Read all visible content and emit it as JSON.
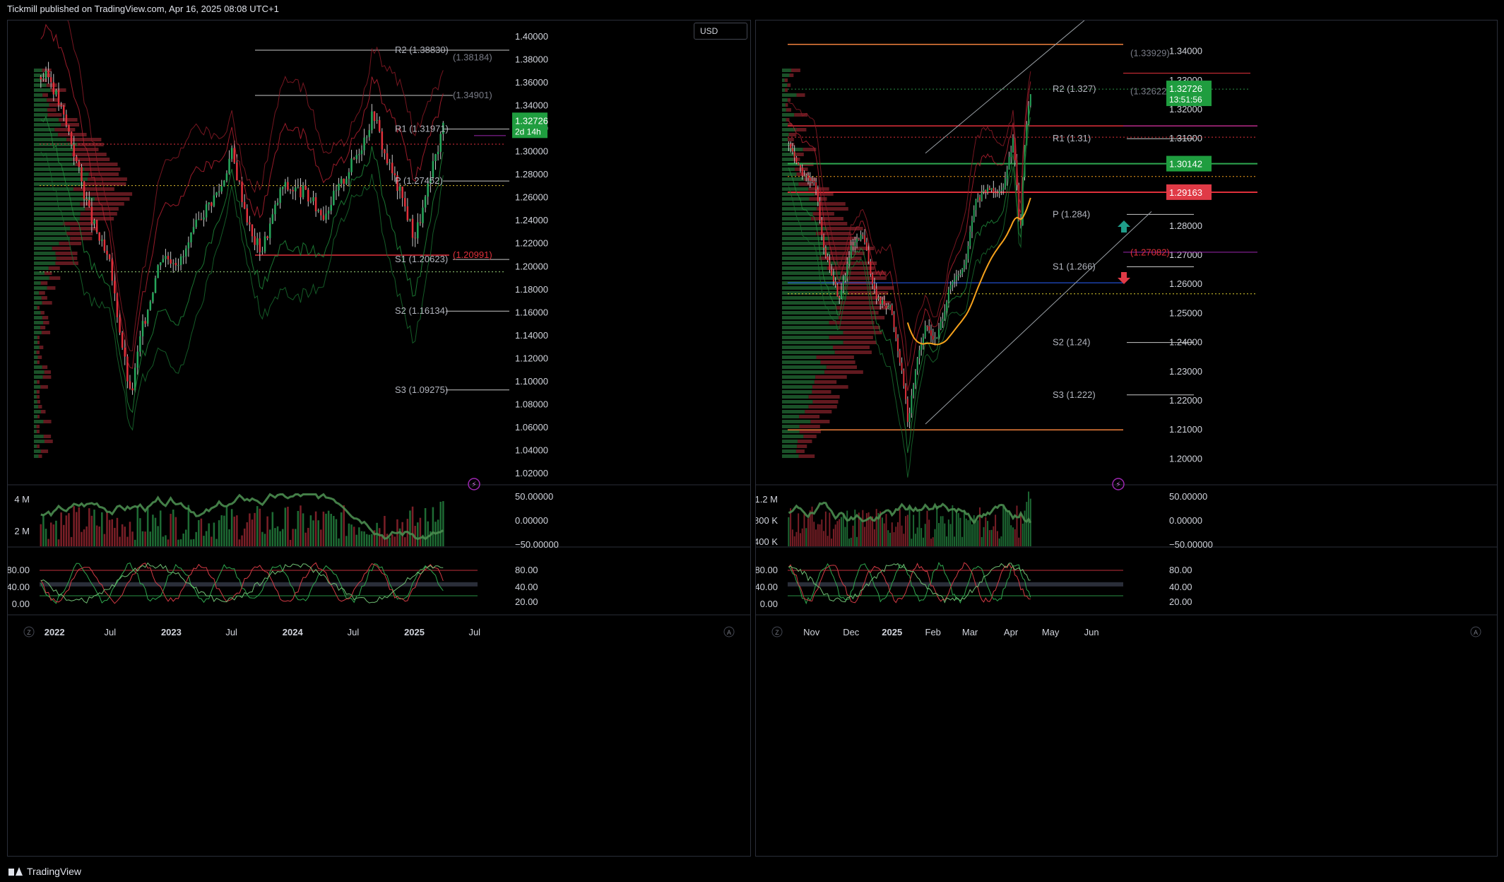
{
  "header": {
    "publish_text": "Tickmill published on TradingView.com, Apr 16, 2025 08:08 UTC+1"
  },
  "footer": {
    "brand": "TradingView"
  },
  "colors": {
    "bull": "#26a65b",
    "bear": "#e0303b",
    "bg": "#000000",
    "grid": "#1c1f26",
    "text": "#d1d4dc",
    "green_tag": "#1f9d3f",
    "red_tag": "#e03a46",
    "ema": "#f7a21c",
    "purple": "#9c27b0"
  },
  "left": {
    "currency_label": "USD",
    "price_axis": [
      "1.40000",
      "1.38000",
      "1.36000",
      "1.34000",
      "1.32000",
      "1.30000",
      "1.28000",
      "1.26000",
      "1.24000",
      "1.22000",
      "1.20000",
      "1.18000",
      "1.16000",
      "1.14000",
      "1.12000",
      "1.10000",
      "1.08000",
      "1.06000",
      "1.04000",
      "1.02000"
    ],
    "time_axis": [
      "2022",
      "Jul",
      "2023",
      "Jul",
      "2024",
      "Jul",
      "2025",
      "Jul"
    ],
    "current_price": "1.32726",
    "countdown": "2d 14h",
    "pivot_labels": {
      "r2": "R2 (1.38830)",
      "r2b": "(1.38184)",
      "r1b": "(1.34901)",
      "r1": "R1 (1.31971)",
      "p": "P (1.27452)",
      "s1": "S1 (1.20623)",
      "s1b": "(1.20991)",
      "s2": "S2 (1.16134)",
      "s3": "S3 (1.09275)"
    },
    "volume_axis": [
      "4 M",
      "2 M"
    ],
    "osc_axis": [
      "50.00000",
      "0.00000",
      "−50.00000"
    ],
    "stoch_axis_left": [
      "80.00",
      "40.00",
      "0.00"
    ],
    "stoch_axis_right": [
      "80.00",
      "40.00",
      "20.00"
    ]
  },
  "right": {
    "price_axis": [
      "1.34000",
      "1.33000",
      "1.32000",
      "1.31000",
      "1.30000",
      "1.29000",
      "1.28000",
      "1.27000",
      "1.26000",
      "1.25000",
      "1.24000",
      "1.23000",
      "1.22000",
      "1.21000",
      "1.20000"
    ],
    "time_axis": [
      "Nov",
      "Dec",
      "2025",
      "Feb",
      "Mar",
      "Apr",
      "May",
      "Jun"
    ],
    "current_price": "1.32726",
    "countdown": "13:51:56",
    "support_tag": "1.30142",
    "resist_tag": "1.29163",
    "pivot_labels": {
      "top": "(1.33929)",
      "r2": "R2 (1.327)",
      "r2b": "(1.32622)",
      "r1": "R1 (1.31)",
      "p": "P (1.284)",
      "pb": "(1.27082)",
      "s1": "S1 (1.266)",
      "s2": "S2 (1.24)",
      "s3": "S3 (1.222)"
    },
    "volume_axis": [
      "1.2 M",
      "800 K",
      "400 K"
    ],
    "osc_axis": [
      "50.00000",
      "0.00000",
      "−50.00000"
    ],
    "stoch_axis_left": [
      "80.00",
      "40.00",
      "0.00"
    ],
    "stoch_axis_right": [
      "80.00",
      "40.00",
      "20.00"
    ]
  },
  "chart_data": [
    {
      "type": "candlestick",
      "title": "",
      "instrument_currency": "USD",
      "timeframe": "weekly",
      "x_range": [
        "2022",
        "Jul 2025"
      ],
      "ylim": [
        1.02,
        1.4
      ],
      "close_path": [
        [
          "2022-01",
          1.365
        ],
        [
          "2022-03",
          1.315
        ],
        [
          "2022-05",
          1.245
        ],
        [
          "2022-07",
          1.2
        ],
        [
          "2022-09",
          1.085
        ],
        [
          "2022-10",
          1.14
        ],
        [
          "2022-12",
          1.21
        ],
        [
          "2023-02",
          1.205
        ],
        [
          "2023-04",
          1.245
        ],
        [
          "2023-06",
          1.27
        ],
        [
          "2023-07",
          1.3
        ],
        [
          "2023-09",
          1.225
        ],
        [
          "2023-10",
          1.215
        ],
        [
          "2023-12",
          1.27
        ],
        [
          "2024-02",
          1.265
        ],
        [
          "2024-04",
          1.245
        ],
        [
          "2024-06",
          1.275
        ],
        [
          "2024-08",
          1.31
        ],
        [
          "2024-09",
          1.335
        ],
        [
          "2024-10",
          1.3
        ],
        [
          "2024-12",
          1.255
        ],
        [
          "2025-01",
          1.225
        ],
        [
          "2025-02",
          1.255
        ],
        [
          "2025-03",
          1.29
        ],
        [
          "2025-04",
          1.327
        ]
      ],
      "last": 1.32726,
      "pivots": {
        "R2": 1.3883,
        "R1": 1.31971,
        "P": 1.27452,
        "S1": 1.20623,
        "S2": 1.16134,
        "S3": 1.09275
      },
      "stochastic_levels": [
        80,
        20
      ]
    },
    {
      "type": "candlestick",
      "title": "",
      "timeframe": "daily",
      "x_range": [
        "Oct 2024",
        "Jun 2025"
      ],
      "ylim": [
        1.195,
        1.345
      ],
      "close_path": [
        [
          "2024-10-15",
          1.308
        ],
        [
          "2024-10-25",
          1.298
        ],
        [
          "2024-11-05",
          1.293
        ],
        [
          "2024-11-10",
          1.272
        ],
        [
          "2024-11-22",
          1.255
        ],
        [
          "2024-12-01",
          1.272
        ],
        [
          "2024-12-10",
          1.277
        ],
        [
          "2024-12-20",
          1.255
        ],
        [
          "2024-12-31",
          1.252
        ],
        [
          "2025-01-10",
          1.226
        ],
        [
          "2025-01-13",
          1.212
        ],
        [
          "2025-01-20",
          1.235
        ],
        [
          "2025-01-27",
          1.246
        ],
        [
          "2025-02-03",
          1.24
        ],
        [
          "2025-02-14",
          1.259
        ],
        [
          "2025-02-25",
          1.266
        ],
        [
          "2025-03-05",
          1.288
        ],
        [
          "2025-03-15",
          1.293
        ],
        [
          "2025-03-25",
          1.292
        ],
        [
          "2025-04-03",
          1.31
        ],
        [
          "2025-04-08",
          1.276
        ],
        [
          "2025-04-11",
          1.307
        ],
        [
          "2025-04-16",
          1.327
        ]
      ],
      "last": 1.32726,
      "levels": {
        "support": 1.30142,
        "resistance": 1.29163
      },
      "pivots": {
        "R2": 1.327,
        "R1": 1.31,
        "P": 1.284,
        "S1": 1.266,
        "S2": 1.24,
        "S3": 1.222
      },
      "stochastic_levels": [
        80,
        20
      ]
    }
  ]
}
